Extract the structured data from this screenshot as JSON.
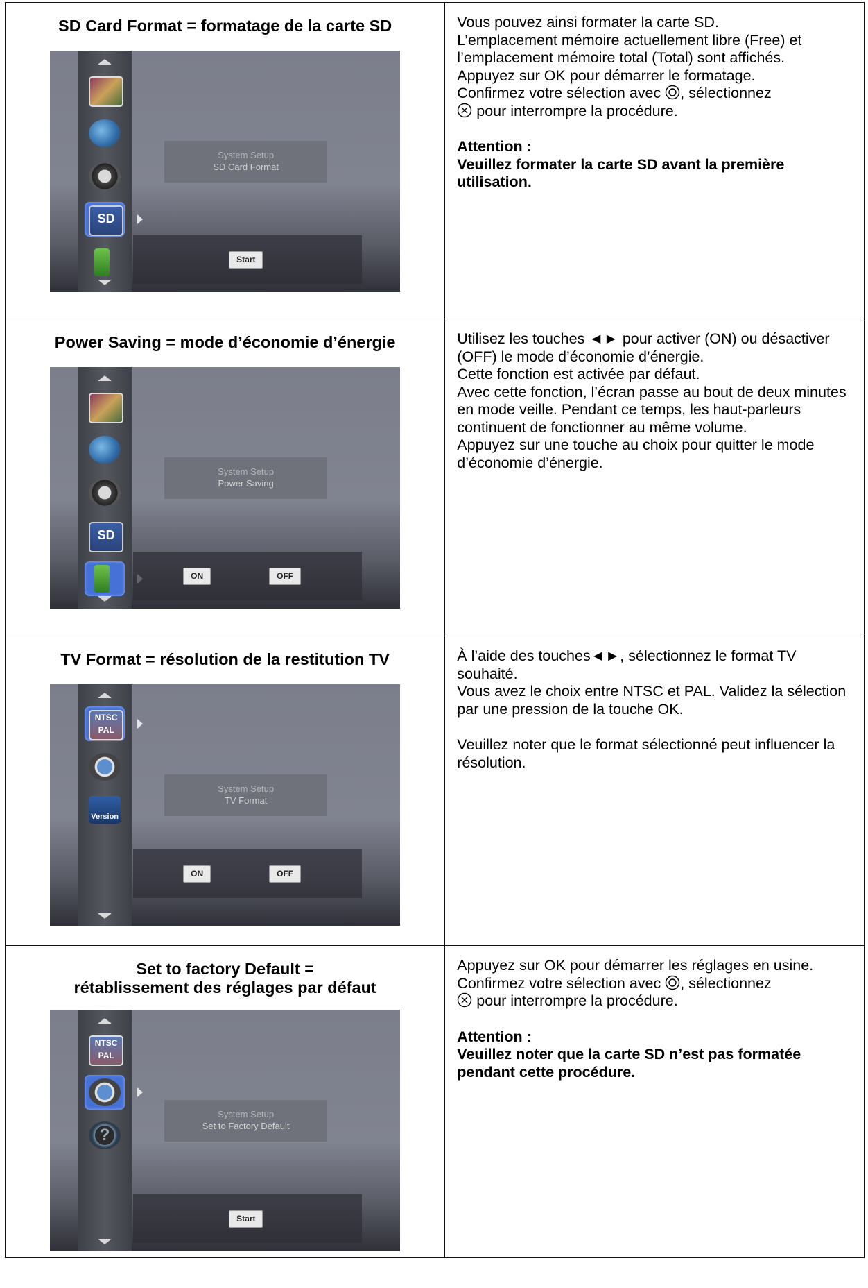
{
  "rows": [
    {
      "heading": "SD Card Format = formatage de la carte SD",
      "screen": {
        "title_line1": "System Setup",
        "title_line2": "SD Card Format",
        "start_label": "Start",
        "sd_icon_text": "SD"
      },
      "desc": {
        "p1": "Vous pouvez ainsi formater la carte SD.",
        "p2": "L’emplacement mémoire actuellement libre (Free) et l’emplacement mémoire total (Total) sont affichés.",
        "p3": "Appuyez sur OK pour démarrer le formatage.",
        "p4a": "Confirmez votre sélection avec ",
        "p4b": ", sélectionnez",
        "p5": " pour interrompre la procédure.",
        "warn_title": "Attention :",
        "warn_text": "Veuillez formater la carte SD avant la première utilisation."
      }
    },
    {
      "heading": "Power Saving = mode d’économie d’énergie",
      "screen": {
        "title_line1": "System Setup",
        "title_line2": "Power Saving",
        "on_label": "ON",
        "off_label": "OFF",
        "sd_icon_text": "SD"
      },
      "desc": {
        "p1": "Utilisez les touches ◄► pour activer (ON) ou désactiver (OFF) le mode d’économie d’énergie.",
        "p2": "Cette fonction est activée par défaut.",
        "p3": "Avec cette fonction, l’écran passe au bout de deux minutes en mode veille. Pendant ce temps, les haut-parleurs continuent de fonctionner au même volume.",
        "p4": "Appuyez sur une touche au choix pour quitter le mode d’économie d’énergie."
      }
    },
    {
      "heading": "TV Format = résolution de la restitution TV",
      "screen": {
        "title_line1": "System Setup",
        "title_line2": "TV Format",
        "on_label": "ON",
        "off_label": "OFF",
        "tv_icon_text": "NTSC PAL",
        "version_label": "Version"
      },
      "desc": {
        "p1": "À l’aide des touches◄►, sélectionnez le format TV souhaité.",
        "p2": "Vous avez le choix entre NTSC et PAL. Validez la sélection par une pression de la touche OK.",
        "p3": "Veuillez noter que le format sélectionné peut influencer la résolution."
      }
    },
    {
      "heading_line1": "Set to factory Default =",
      "heading_line2": "rétablissement des réglages par défaut",
      "screen": {
        "title_line1": "System Setup",
        "title_line2": "Set to Factory Default",
        "start_label": "Start",
        "tv_icon_text": "NTSC PAL",
        "help_icon_text": "?"
      },
      "desc": {
        "p1": "Appuyez sur OK pour démarrer les réglages en usine.",
        "p2a": "Confirmez votre sélection avec ",
        "p2b": ", sélectionnez",
        "p3": " pour interrompre la procédure.",
        "warn_title": "Attention :",
        "warn_text": "Veuillez noter que la carte SD n’est pas formatée pendant cette procédure."
      }
    }
  ]
}
